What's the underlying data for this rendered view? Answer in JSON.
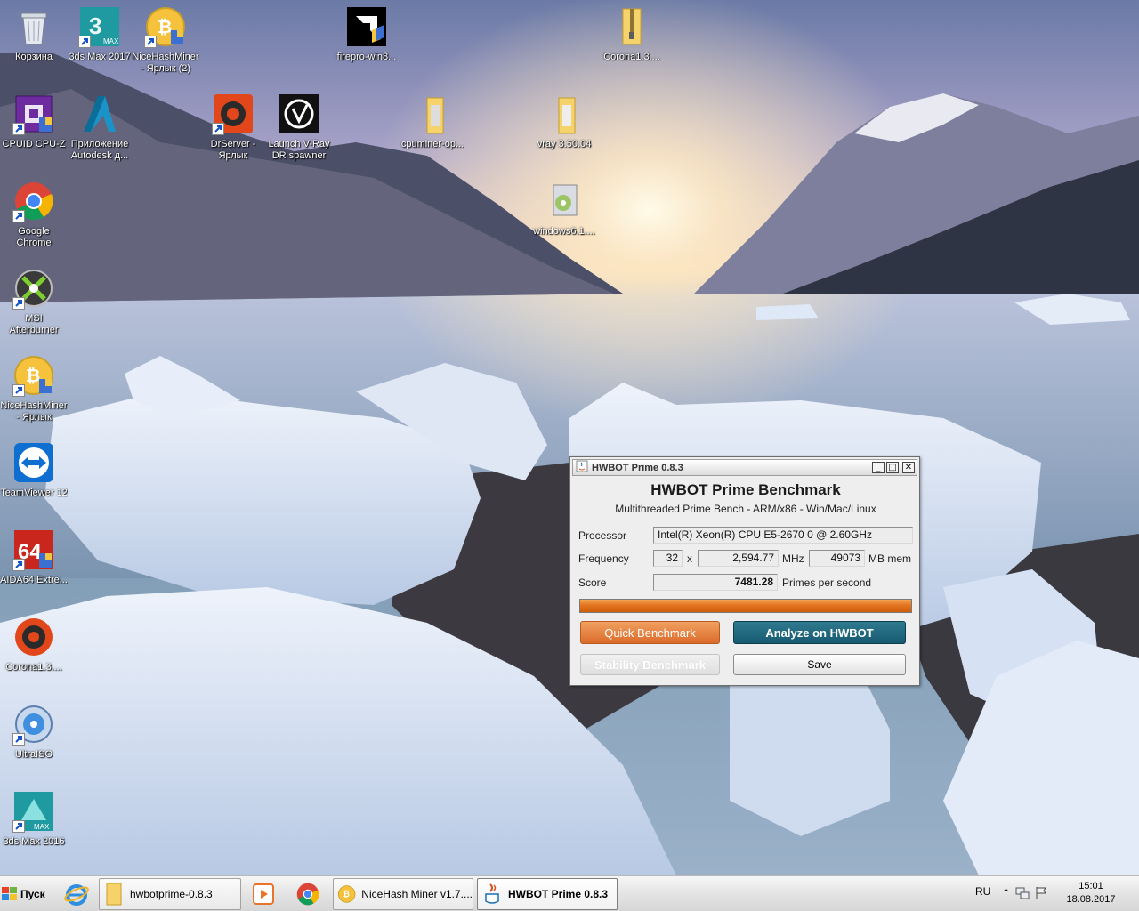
{
  "desktop": {
    "icons": [
      {
        "name": "recycle-bin",
        "label": "Корзина"
      },
      {
        "name": "3ds-max-2017",
        "label": "3ds Max 2017"
      },
      {
        "name": "nicehashminer-shortcut-2",
        "label": "NiceHashMiner - Ярлык (2)"
      },
      {
        "name": "firepro-win8",
        "label": "firepro-win8..."
      },
      {
        "name": "corona-folder",
        "label": "Corona1.3...."
      },
      {
        "name": "cpuid-cpu-z",
        "label": "CPUID CPU-Z"
      },
      {
        "name": "autodesk-app",
        "label": "Приложение Autodesk д..."
      },
      {
        "name": "drserver",
        "label": "DrServer - Ярлык"
      },
      {
        "name": "vray-dr-spawner",
        "label": "Launch V-Ray DR spawner"
      },
      {
        "name": "cpuminer-folder",
        "label": "cpuminer-op..."
      },
      {
        "name": "vray-folder",
        "label": "vray 3.50.04"
      },
      {
        "name": "google-chrome",
        "label": "Google Chrome"
      },
      {
        "name": "windows6-installer",
        "label": "windows6.1...."
      },
      {
        "name": "msi-afterburner",
        "label": "MSI Afterburner"
      },
      {
        "name": "nicehashminer-shortcut",
        "label": "NiceHashMiner - Ярлык"
      },
      {
        "name": "teamviewer-12",
        "label": "TeamViewer 12"
      },
      {
        "name": "aida64",
        "label": "AIDA64 Extre..."
      },
      {
        "name": "corona-app",
        "label": "Corona1.3...."
      },
      {
        "name": "ultraiso",
        "label": "UltraISO"
      },
      {
        "name": "3ds-max-2016",
        "label": "3ds Max 2016"
      }
    ]
  },
  "window": {
    "title": "HWBOT Prime 0.8.3",
    "controls": {
      "minimize": "_",
      "maximize": "□",
      "close": "✕"
    },
    "heading": "HWBOT Prime Benchmark",
    "subtitle": "Multithreaded Prime Bench - ARM/x86 - Win/Mac/Linux",
    "processor_label": "Processor",
    "processor_value": "Intel(R) Xeon(R) CPU E5-2670 0 @ 2.60GHz",
    "frequency_label": "Frequency",
    "cores": "32",
    "times": "x",
    "frequency_value": "2,594.77",
    "mhz": "MHz",
    "memory_value": "49073",
    "mb_mem": "MB mem",
    "score_label": "Score",
    "score_value": "7481.28",
    "score_unit": "Primes per second",
    "progress": 1.0,
    "buttons": {
      "quick": "Quick Benchmark",
      "analyze": "Analyze on HWBOT",
      "stability": "Stability Benchmark",
      "save": "Save"
    }
  },
  "taskbar": {
    "start_label": "Пуск",
    "items": [
      {
        "label": "hwbotprime-0.8.3"
      },
      {
        "label": "NiceHash Miner v1.7...."
      },
      {
        "label": "HWBOT Prime 0.8.3"
      }
    ],
    "language": "RU",
    "time": "15:01",
    "date": "18.08.2017"
  },
  "colors": {
    "progress": "#e3741f",
    "quick_button": "#db6b2a",
    "analyze_button": "#175a70"
  }
}
